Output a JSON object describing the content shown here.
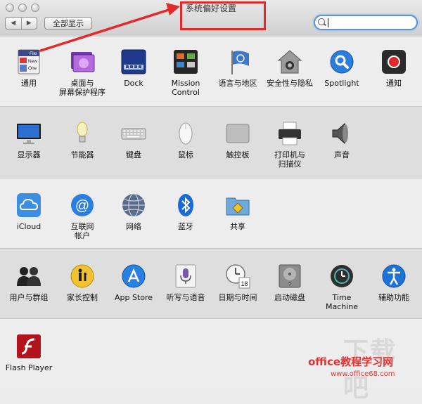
{
  "window": {
    "title": "系统偏好设置"
  },
  "toolbar": {
    "back_glyph": "◀",
    "forward_glyph": "▶",
    "show_all_label": "全部显示",
    "search_placeholder": ""
  },
  "sections": [
    {
      "items": [
        {
          "label": "通用",
          "icon": "general-icon"
        },
        {
          "label": "桌面与\n屏幕保护程序",
          "icon": "desktop-screensaver-icon"
        },
        {
          "label": "Dock",
          "icon": "dock-icon"
        },
        {
          "label": "Mission\nControl",
          "icon": "mission-control-icon"
        },
        {
          "label": "语言与地区",
          "icon": "language-region-icon"
        },
        {
          "label": "安全性与隐私",
          "icon": "security-privacy-icon"
        },
        {
          "label": "Spotlight",
          "icon": "spotlight-icon"
        },
        {
          "label": "通知",
          "icon": "notifications-icon"
        }
      ]
    },
    {
      "items": [
        {
          "label": "显示器",
          "icon": "displays-icon"
        },
        {
          "label": "节能器",
          "icon": "energy-saver-icon"
        },
        {
          "label": "键盘",
          "icon": "keyboard-icon"
        },
        {
          "label": "鼠标",
          "icon": "mouse-icon"
        },
        {
          "label": "触控板",
          "icon": "trackpad-icon"
        },
        {
          "label": "打印机与\n扫描仪",
          "icon": "printers-scanners-icon"
        },
        {
          "label": "声音",
          "icon": "sound-icon"
        }
      ]
    },
    {
      "items": [
        {
          "label": "iCloud",
          "icon": "icloud-icon"
        },
        {
          "label": "互联网\n帐户",
          "icon": "internet-accounts-icon"
        },
        {
          "label": "网络",
          "icon": "network-icon"
        },
        {
          "label": "蓝牙",
          "icon": "bluetooth-icon"
        },
        {
          "label": "共享",
          "icon": "sharing-icon"
        }
      ]
    },
    {
      "items": [
        {
          "label": "用户与群组",
          "icon": "users-groups-icon"
        },
        {
          "label": "家长控制",
          "icon": "parental-controls-icon"
        },
        {
          "label": "App Store",
          "icon": "app-store-icon"
        },
        {
          "label": "听写与语音",
          "icon": "dictation-speech-icon"
        },
        {
          "label": "日期与时间",
          "icon": "date-time-icon"
        },
        {
          "label": "启动磁盘",
          "icon": "startup-disk-icon"
        },
        {
          "label": "Time Machine",
          "icon": "time-machine-icon"
        },
        {
          "label": "辅助功能",
          "icon": "accessibility-icon"
        }
      ]
    },
    {
      "items": [
        {
          "label": "Flash Player",
          "icon": "flash-player-icon"
        }
      ]
    }
  ],
  "icon_text": {
    "general_file": "File",
    "general_new": "New",
    "general_one": "One",
    "date_day": "18"
  },
  "watermark": {
    "main": "下载吧",
    "site_cn": "office教程学习网",
    "site_url": "www.office68.com"
  },
  "colors": {
    "annotation_red": "#e32a2a",
    "search_focus": "#5b93d8"
  }
}
